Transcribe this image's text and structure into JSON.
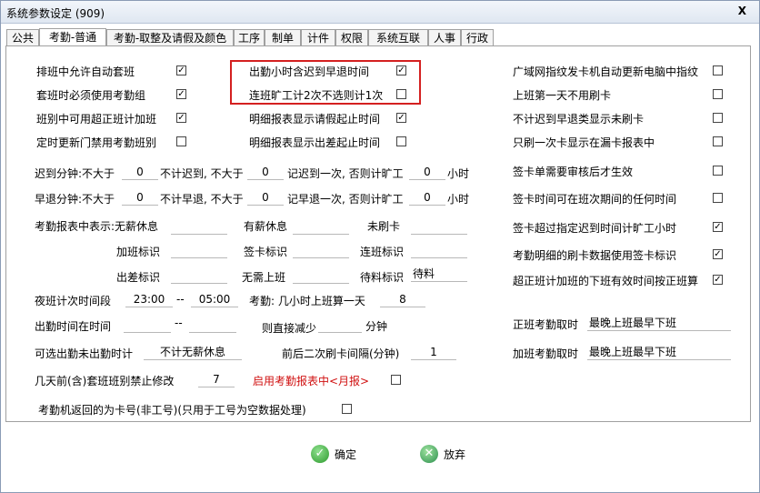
{
  "window": {
    "title": "系统参数设定 (909)",
    "close_label": "X"
  },
  "tabs": [
    {
      "label": "公共"
    },
    {
      "label": "考勤-普通"
    },
    {
      "label": "考勤-取整及请假及颜色"
    },
    {
      "label": "工序"
    },
    {
      "label": "制单"
    },
    {
      "label": "计件"
    },
    {
      "label": "权限"
    },
    {
      "label": "系统互联"
    },
    {
      "label": "人事"
    },
    {
      "label": "行政"
    }
  ],
  "col1": [
    {
      "label": "排班中允许自动套班",
      "checked": true
    },
    {
      "label": "套班时必须使用考勤组",
      "checked": true
    },
    {
      "label": "班别中可用超正班计加班",
      "checked": true
    },
    {
      "label": "定时更新门禁用考勤班别",
      "checked": false
    }
  ],
  "col2": [
    {
      "label": "出勤小时含迟到早退时间",
      "checked": true
    },
    {
      "label": "连班旷工计2次不选则计1次",
      "checked": false
    },
    {
      "label": "明细报表显示请假起止时间",
      "checked": true
    },
    {
      "label": "明细报表显示出差起止时间",
      "checked": false
    }
  ],
  "col3": [
    {
      "label": "广域网指纹发卡机自动更新电脑中指纹",
      "checked": false
    },
    {
      "label": "上班第一天不用刷卡",
      "checked": false
    },
    {
      "label": "不计迟到早退类显示未刷卡",
      "checked": false
    },
    {
      "label": "只刷一次卡显示在漏卡报表中",
      "checked": false
    },
    {
      "label": "签卡单需要审核后才生效",
      "checked": false
    },
    {
      "label": "签卡时间可在班次期间的任何时间",
      "checked": false
    },
    {
      "label": "签卡超过指定迟到时间计旷工小时",
      "checked": true
    },
    {
      "label": "考勤明细的刷卡数据使用签卡标识",
      "checked": true
    },
    {
      "label": "超正班计加班的下班有效时间按正班算",
      "checked": true
    }
  ],
  "late": {
    "l1": "迟到分钟:不大于",
    "v1": "0",
    "l2": "不计迟到, 不大于",
    "v2": "0",
    "l3": "记迟到一次, 否则计旷工",
    "v3": "0",
    "unit": "小时"
  },
  "early": {
    "l1": "早退分钟:不大于",
    "v1": "0",
    "l2": "不计早退, 不大于",
    "v2": "0",
    "l3": "记早退一次, 否则计旷工",
    "v3": "0",
    "unit": "小时"
  },
  "marks": {
    "paid_leave": "考勤报表中表示:无薪休息",
    "paid_rest": "有薪休息",
    "no_card": "未刷卡",
    "overtime": "加班标识",
    "sign": "签卡标识",
    "consecutive": "连班标识",
    "trip": "出差标识",
    "no_work": "无需上班",
    "pending": "待料标识",
    "pending_value": "待料"
  },
  "night": {
    "label": "夜班计次时间段",
    "from": "23:00",
    "dash": "--",
    "to": "05:00",
    "att_label": "考勤: 几小时上班算一天",
    "att_value": "8"
  },
  "duty": {
    "label": "出勤时间在时间",
    "dash": "--",
    "reduce": "则直接减少",
    "unit": "分钟"
  },
  "optional": {
    "label": "可选出勤未出勤时计",
    "value": "不计无薪休息",
    "interval_label": "前后二次刷卡间隔(分钟)",
    "interval_value": "1"
  },
  "days": {
    "label": "几天前(含)套班班别禁止修改",
    "value": "7",
    "monthly_label": "启用考勤报表中<月报>",
    "monthly_checked": false
  },
  "cardno": {
    "label": "考勤机返回的为卡号(非工号)(只用于工号为空数据处理)",
    "checked": false
  },
  "regular": {
    "label": "正班考勤取时",
    "value": "最晚上班最早下班"
  },
  "ot": {
    "label": "加班考勤取时",
    "value": "最晚上班最早下班"
  },
  "buttons": {
    "ok": "确定",
    "cancel": "放弃"
  }
}
